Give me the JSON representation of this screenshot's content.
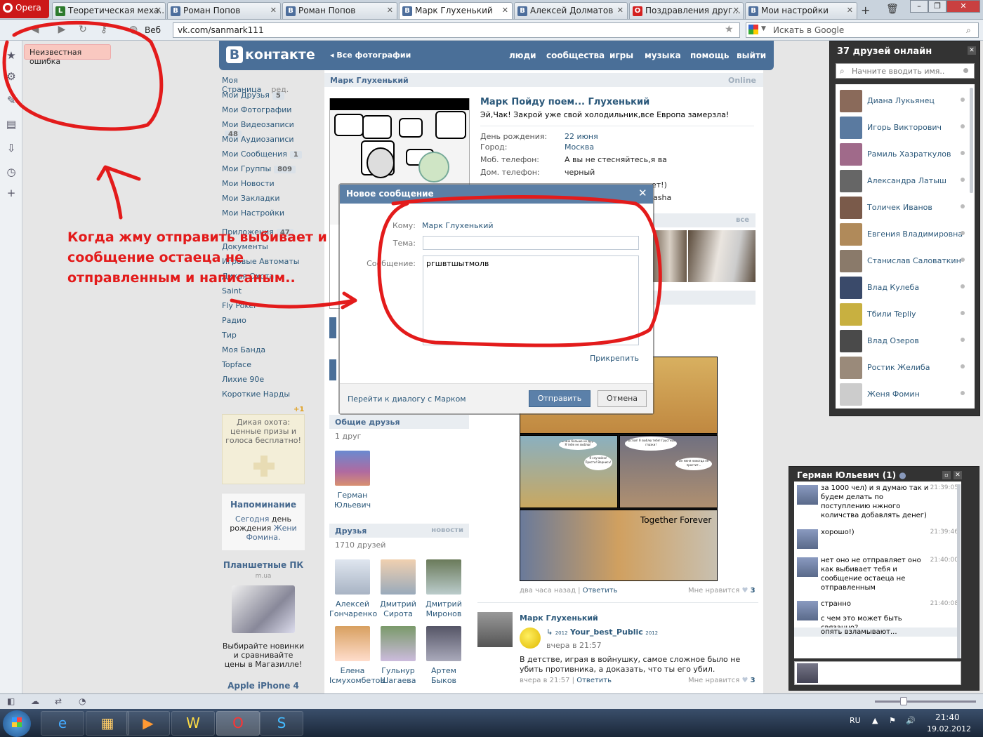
{
  "browser": {
    "menu_label": "Opera",
    "tabs": [
      {
        "label": "Теоретическая меха...",
        "icon": "lp"
      },
      {
        "label": "Роман Попов",
        "icon": "B"
      },
      {
        "label": "Роман Попов",
        "icon": "B"
      },
      {
        "label": "Марк Глухенький",
        "icon": "B",
        "active": true
      },
      {
        "label": "Алексей Долматов",
        "icon": "B"
      },
      {
        "label": "Поздравления друг...",
        "icon": "opera"
      },
      {
        "label": "Мои настройки",
        "icon": "B"
      }
    ],
    "web_label": "Веб",
    "address": "vk.com/sanmark111",
    "search_placeholder": "Искать в Google"
  },
  "error_tip": "Неизвестная ошибка",
  "vk": {
    "logo": "контакте",
    "logo_letter": "В",
    "back_link": "Все фотографии",
    "nav": [
      "люди",
      "сообщества",
      "игры",
      "музыка",
      "помощь",
      "выйти"
    ],
    "menu": [
      {
        "label": "Моя Страница",
        "extra": "ред."
      },
      {
        "label": "Мои Друзья",
        "count": "5"
      },
      {
        "label": "Мои Фотографии"
      },
      {
        "label": "Мои Видеозаписи",
        "count": "48"
      },
      {
        "label": "Мои Аудиозаписи"
      },
      {
        "label": "Мои Сообщения",
        "count": "1"
      },
      {
        "label": "Мои Группы",
        "count": "809"
      },
      {
        "label": "Мои Новости"
      },
      {
        "label": "Мои Закладки"
      },
      {
        "label": "Мои Настройки"
      }
    ],
    "apps_menu": [
      {
        "label": "Приложения",
        "count": "47"
      },
      {
        "label": "Документы"
      },
      {
        "label": "Игровые Автоматы"
      },
      {
        "label": "Дикая Охота"
      },
      {
        "label": "Saint"
      },
      {
        "label": "Fly Poker"
      },
      {
        "label": "Радио"
      },
      {
        "label": "Тир"
      },
      {
        "label": "Моя Банда"
      },
      {
        "label": "Topface"
      },
      {
        "label": "Лихие 90е"
      },
      {
        "label": "Короткие Нарды"
      }
    ],
    "ad_plus": "+1",
    "ad_text": "Дикая охота: ценные призы и голоса бесплатно!",
    "reminder_title": "Напоминание",
    "reminder_text_1": "Сегодня",
    "reminder_text_2": "день рождения",
    "reminder_link": "Жени Фомина.",
    "promo_title": "Планшетные ПК",
    "promo_site": "m.ua",
    "promo_text": "Выбирайте новинки и сравнивайте цены в Магазилле!",
    "promo2_title": "Apple iPhone 4",
    "page_head": "Марк Глухенький",
    "page_status": "Online",
    "profile": {
      "name": "Марк Пойду поем... Глухенький",
      "status": "Эй,Чак! Закрой уже свой холодильник,все Европа замерзла!",
      "fields": [
        {
          "label": "День рождения:",
          "value": "22 июня",
          "link": true
        },
        {
          "label": "Город:",
          "value": "Москва",
          "link": true
        },
        {
          "label": "Моб. телефон:",
          "value": "А вы не стесняйтесь,я ва"
        },
        {
          "label": "Дом. телефон:",
          "value": "черный"
        }
      ],
      "partial_1": "ет!)",
      "partial_2": "asha"
    },
    "photos_all": "все",
    "common_friends_title": "Общие друзья",
    "common_friends_count": "1 друг",
    "common_friend_name": "Герман Юльевич",
    "friends_title": "Друзья",
    "friends_link": "новости",
    "friends_count": "1710 друзей",
    "friends": [
      {
        "name": "Алексей Гончаренко"
      },
      {
        "name": "Дмитрий Сирота"
      },
      {
        "name": "Дмитрий Миронов"
      },
      {
        "name": "Елена Ісмухомбетов"
      },
      {
        "name": "Гульнур Шагаева"
      },
      {
        "name": "Артем Быков"
      }
    ],
    "wall_photo_text": "Together Forever",
    "bubble_1": "Ты мне больше не друг! Я тебе не люблю!",
    "bubble_2": "Я случайно! Прости! Вернись!",
    "bubble_3": "Постой! Я люблю тебя! Грустные глазки!",
    "bubble_4": "Он меня никогда не простит...",
    "post1_time": "два часа назад",
    "post1_reply": "Ответить",
    "post1_like": "Мне нравится",
    "post1_like_count": "3",
    "post2_author": "Марк Глухенький",
    "post2_group": "Your_best_Public",
    "post2_year1": "2012",
    "post2_year2": "2012",
    "post2_time": "вчера в 21:57",
    "post2_text": "В детстве, играя в войнушку, самое сложное было не убить противника, а доказать, что ты его убил.",
    "post2_meta_time": "вчера в 21:57",
    "post2_reply": "Ответить",
    "post2_like": "Мне нравится",
    "post2_like_count": "3"
  },
  "modal": {
    "title": "Новое сообщение",
    "to_label": "Кому:",
    "to_value": "Марк Глухенький",
    "subject_label": "Тема:",
    "message_label": "Сообщение:",
    "message_value": "ргшвтшытмолв",
    "attach": "Прикрепить",
    "dialog_link": "Перейти к диалогу с Марком",
    "send": "Отправить",
    "cancel": "Отмена"
  },
  "annotation": "Когда жму отправить выбивает и сообщение остаеца не отправленным и написаным..",
  "friends_online": {
    "title": "37 друзей онлайн",
    "search_placeholder": "Начните вводить имя..",
    "items": [
      {
        "name": "Диана Лукьянец",
        "color": "#8a6a5a"
      },
      {
        "name": "Игорь Викторович",
        "color": "#5a7aa0"
      },
      {
        "name": "Рамиль Хазраткулов",
        "color": "#a06a8a"
      },
      {
        "name": "Александра Латыш",
        "color": "#666666"
      },
      {
        "name": "Толичек Иванов",
        "color": "#7a5a4a"
      },
      {
        "name": "Евгения Владимировна",
        "color": "#b08a5a"
      },
      {
        "name": "Станислав Саловаткин",
        "color": "#8a7a6a"
      },
      {
        "name": "Влад Кулеба",
        "color": "#3a4a6a"
      },
      {
        "name": "Тбили Tepliy",
        "color": "#c8b040"
      },
      {
        "name": "Влад Озеров",
        "color": "#4a4a4a"
      },
      {
        "name": "Ростик Желиба",
        "color": "#9a8a7a"
      },
      {
        "name": "Женя Фомин",
        "color": "#cccccc"
      }
    ]
  },
  "chat": {
    "title": "Герман Юльевич (1)",
    "messages": [
      {
        "text": "за 1000 чел) и я думаю так и будем делать по поступлению нжного количства добавлять денег)",
        "time": "21:39:05"
      },
      {
        "text": "хорошо!)",
        "time": "21:39:46"
      },
      {
        "text": "нет оно не отправляет оно как выбивает тебя и сообщение остаеца не отправленным",
        "time": "21:40:00"
      },
      {
        "text": "странно",
        "time": "21:40:08"
      },
      {
        "text": "с чем это может быть связанно?",
        "time": ""
      },
      {
        "text": "опять взламывают...",
        "time": ""
      }
    ]
  },
  "taskbar": {
    "lang": "RU",
    "time": "21:40",
    "date": "19.02.2012"
  }
}
